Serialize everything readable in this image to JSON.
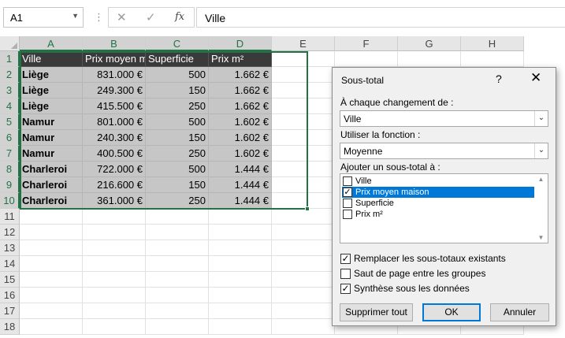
{
  "formula_bar": {
    "name_box": "A1",
    "separator": "⋮",
    "cancel_glyph": "✕",
    "enter_glyph": "✓",
    "fx_label": "fx",
    "content": "Ville"
  },
  "columns": [
    "A",
    "B",
    "C",
    "D",
    "E",
    "F",
    "G",
    "H"
  ],
  "rows": [
    "1",
    "2",
    "3",
    "4",
    "5",
    "6",
    "7",
    "8",
    "9",
    "10",
    "11",
    "12",
    "13",
    "14",
    "15",
    "16",
    "17",
    "18"
  ],
  "table": {
    "headers": [
      "Ville",
      "Prix moyen maison",
      "Superficie",
      "Prix m²"
    ],
    "rows": [
      [
        "Liège",
        "831.000 €",
        "500",
        "1.662 €"
      ],
      [
        "Liège",
        "249.300 €",
        "150",
        "1.662 €"
      ],
      [
        "Liège",
        "415.500 €",
        "250",
        "1.662 €"
      ],
      [
        "Namur",
        "801.000 €",
        "500",
        "1.602 €"
      ],
      [
        "Namur",
        "240.300 €",
        "150",
        "1.602 €"
      ],
      [
        "Namur",
        "400.500 €",
        "250",
        "1.602 €"
      ],
      [
        "Charleroi",
        "722.000 €",
        "500",
        "1.444 €"
      ],
      [
        "Charleroi",
        "216.600 €",
        "150",
        "1.444 €"
      ],
      [
        "Charleroi",
        "361.000 €",
        "250",
        "1.444 €"
      ]
    ]
  },
  "dialog": {
    "title": "Sous-total",
    "help": "?",
    "close": "✕",
    "change_label": "À chaque changement de :",
    "change_value": "Ville",
    "function_label": "Utiliser la fonction :",
    "function_value": "Moyenne",
    "add_label": "Ajouter un sous-total à :",
    "list": [
      {
        "label": "Ville",
        "checked": false,
        "selected": false
      },
      {
        "label": "Prix moyen maison",
        "checked": true,
        "selected": true
      },
      {
        "label": "Superficie",
        "checked": false,
        "selected": false
      },
      {
        "label": "Prix m²",
        "checked": false,
        "selected": false
      }
    ],
    "options": [
      {
        "label": "Remplacer les sous-totaux existants",
        "checked": true
      },
      {
        "label": "Saut de page entre les groupes",
        "checked": false
      },
      {
        "label": "Synthèse sous les données",
        "checked": true
      }
    ],
    "buttons": {
      "remove_all": "Supprimer tout",
      "ok": "OK",
      "cancel": "Annuler"
    }
  }
}
